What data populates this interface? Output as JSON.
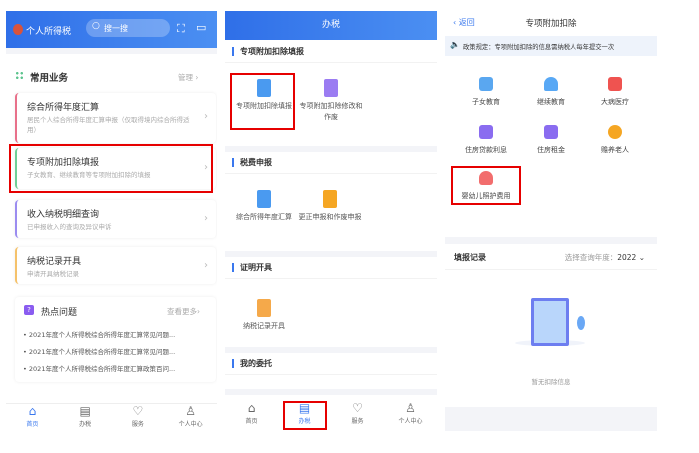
{
  "screen1": {
    "app_title": "个人所得税",
    "search_placeholder": "搜一搜",
    "section_title": "常用业务",
    "manage": "管理",
    "cards": [
      {
        "title": "综合所得年度汇算",
        "subtitle": "居民个人综合所得年度汇算申报（仅取得境内综合所得适用）",
        "color": "#e8708a"
      },
      {
        "title": "专项附加扣除填报",
        "subtitle": "子女教育、继续教育等专项附加扣除的填报",
        "color": "#6fcf97"
      },
      {
        "title": "收入纳税明细查询",
        "subtitle": "已申报收入的查询及异议申诉",
        "color": "#9b8cf0"
      },
      {
        "title": "纳税记录开具",
        "subtitle": "申请开具纳税记录",
        "color": "#f5c26b"
      }
    ],
    "hot": {
      "title": "热点问题",
      "more": "查看更多",
      "items": [
        "2021年度个人所得税综合所得年度汇算常见问题...",
        "2021年度个人所得税综合所得年度汇算常见问题...",
        "2021年度个人所得税综合所得年度汇算政策百问..."
      ]
    },
    "nav": [
      "首页",
      "办税",
      "服务",
      "个人中心"
    ]
  },
  "screen2": {
    "title": "办税",
    "sections": [
      {
        "title": "专项附加扣除填报",
        "items": [
          "专项附加扣除填报",
          "专项附加扣除修改和作废"
        ]
      },
      {
        "title": "税费申报",
        "items": [
          "综合所得年度汇算",
          "更正申报和作废申报"
        ]
      },
      {
        "title": "证明开具",
        "items": [
          "纳税记录开具"
        ]
      },
      {
        "title": "我的委托",
        "items": []
      }
    ],
    "nav": [
      "首页",
      "办税",
      "服务",
      "个人中心"
    ]
  },
  "screen3": {
    "back": "返回",
    "title": "专项附加扣除",
    "notice": "政策规定：专项附加扣除的信息需纳税人每年提交一次",
    "items": [
      "子女教育",
      "继续教育",
      "大病医疗",
      "住房贷款利息",
      "住房租金",
      "赡养老人",
      "婴幼儿照护费用"
    ],
    "records_title": "填报记录",
    "year_label": "选择查询年度：",
    "year": "2022",
    "empty": "暂无扣除信息"
  }
}
